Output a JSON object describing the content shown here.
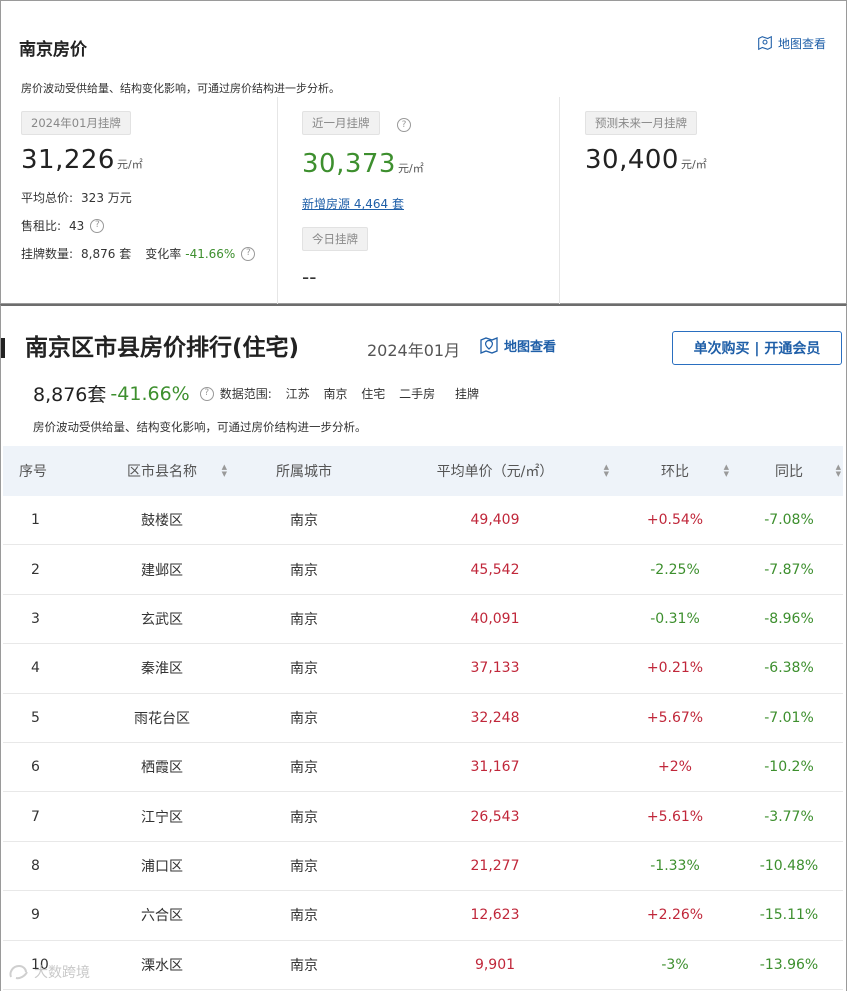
{
  "panel1": {
    "title": "南京房价",
    "map_link": "地图查看",
    "desc": "房价波动受供给量、结构变化影响，可通过房价结构进一步分析。",
    "col1": {
      "tag": "2024年01月挂牌",
      "price": "31,226",
      "unit": "元/㎡",
      "avg_total_label": "平均总价:",
      "avg_total_value": "323 万元",
      "rent_ratio_label": "售租比:",
      "rent_ratio_value": "43",
      "listing_label": "挂牌数量:",
      "listing_value": "8,876 套",
      "change_label": "变化率",
      "change_value": "-41.66%"
    },
    "col2": {
      "tag": "近一月挂牌",
      "price": "30,373",
      "unit": "元/㎡",
      "new_listings": "新增房源 4,464 套",
      "today_tag": "今日挂牌",
      "today_value": "--"
    },
    "col3": {
      "tag": "预测未来一月挂牌",
      "price": "30,400",
      "unit": "元/㎡"
    }
  },
  "panel2": {
    "title": "南京区市县房价排行(住宅)",
    "date": "2024年01月",
    "map_link": "地图查看",
    "member_button": "单次购买 | 开通会员",
    "count": "8,876套",
    "change": "-41.66%",
    "range_label": "数据范围:",
    "range_items": [
      "江苏",
      "南京",
      "住宅",
      "二手房",
      "挂牌"
    ],
    "desc": "房价波动受供给量、结构变化影响，可通过房价结构进一步分析。",
    "headers": [
      "序号",
      "区市县名称",
      "所属城市",
      "平均单价（元/㎡）",
      "环比",
      "同比"
    ],
    "rows": [
      {
        "no": "1",
        "name": "鼓楼区",
        "city": "南京",
        "price": "49,409",
        "hb": "+0.54%",
        "tb": "-7.08%"
      },
      {
        "no": "2",
        "name": "建邺区",
        "city": "南京",
        "price": "45,542",
        "hb": "-2.25%",
        "tb": "-7.87%"
      },
      {
        "no": "3",
        "name": "玄武区",
        "city": "南京",
        "price": "40,091",
        "hb": "-0.31%",
        "tb": "-8.96%"
      },
      {
        "no": "4",
        "name": "秦淮区",
        "city": "南京",
        "price": "37,133",
        "hb": "+0.21%",
        "tb": "-6.38%"
      },
      {
        "no": "5",
        "name": "雨花台区",
        "city": "南京",
        "price": "32,248",
        "hb": "+5.67%",
        "tb": "-7.01%"
      },
      {
        "no": "6",
        "name": "栖霞区",
        "city": "南京",
        "price": "31,167",
        "hb": "+2%",
        "tb": "-10.2%"
      },
      {
        "no": "7",
        "name": "江宁区",
        "city": "南京",
        "price": "26,543",
        "hb": "+5.61%",
        "tb": "-3.77%"
      },
      {
        "no": "8",
        "name": "浦口区",
        "city": "南京",
        "price": "21,277",
        "hb": "-1.33%",
        "tb": "-10.48%"
      },
      {
        "no": "9",
        "name": "六合区",
        "city": "南京",
        "price": "12,623",
        "hb": "+2.26%",
        "tb": "-15.11%"
      },
      {
        "no": "10",
        "name": "溧水区",
        "city": "南京",
        "price": "9,901",
        "hb": "-3%",
        "tb": "-13.96%"
      }
    ]
  },
  "watermark": "大数跨境",
  "colors": {
    "up_red": "#c0273a",
    "down_green": "#3d8f2e",
    "link_blue": "#1f5fa8",
    "header_bg": "#eef3f9"
  }
}
